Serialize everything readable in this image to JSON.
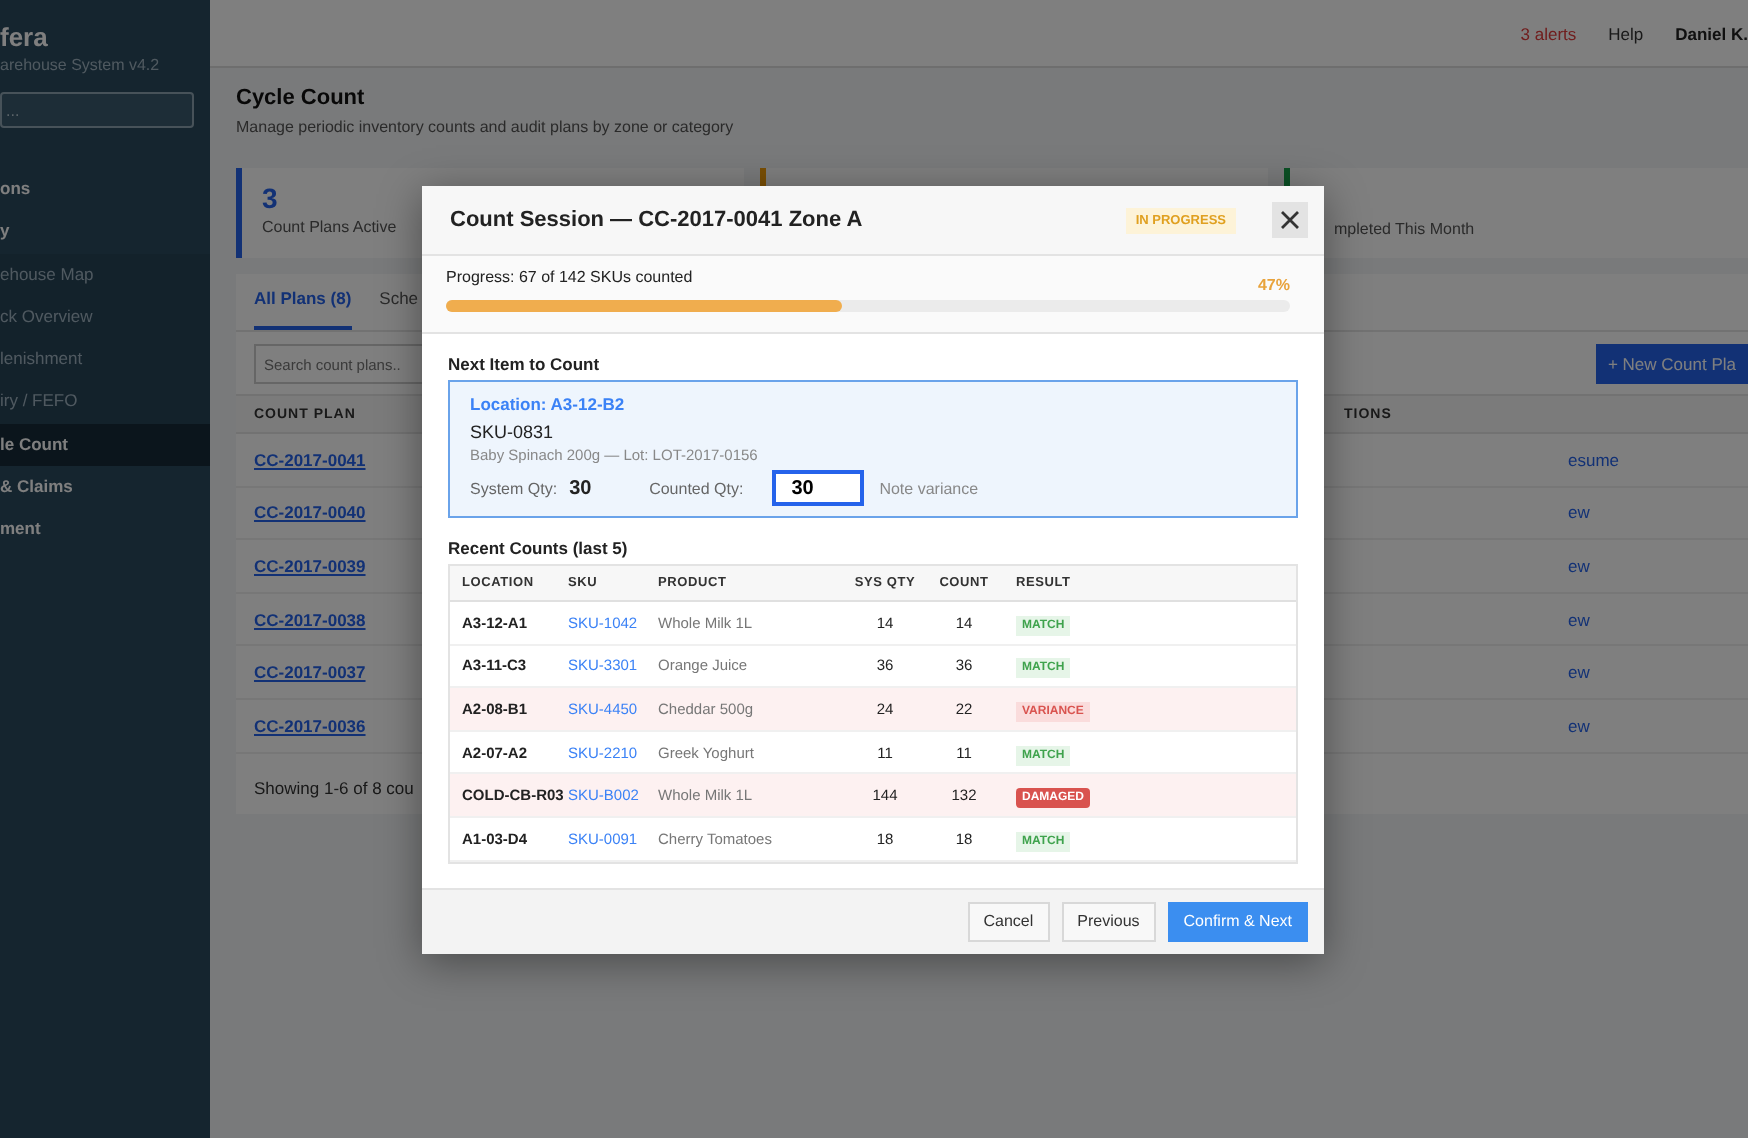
{
  "sidebar": {
    "brand": "fera",
    "subtitle": "arehouse System v4.2",
    "search_placeholder": "...",
    "items": [
      {
        "label": "ons",
        "selected": false,
        "kind": "section"
      },
      {
        "label": "y",
        "selected": false,
        "kind": "section"
      },
      {
        "label": "ehouse Map",
        "selected": false,
        "kind": "sub"
      },
      {
        "label": "ck Overview",
        "selected": false,
        "kind": "sub"
      },
      {
        "label": "lenishment",
        "selected": false,
        "kind": "sub"
      },
      {
        "label": "iry / FEFO",
        "selected": false,
        "kind": "sub"
      },
      {
        "label": "le Count",
        "selected": true,
        "kind": "sub"
      },
      {
        "label": "& Claims",
        "selected": false,
        "kind": "section"
      },
      {
        "label": "ment",
        "selected": false,
        "kind": "section"
      }
    ]
  },
  "topbar": {
    "alerts": "3 alerts",
    "help": "Help",
    "user": "Daniel K."
  },
  "page": {
    "title": "Cycle Count",
    "subtitle": "Manage periodic inventory counts and audit plans by zone or category"
  },
  "stats": [
    {
      "value": "3",
      "label": "Count Plans Active"
    },
    {
      "label": "mpleted This Month"
    }
  ],
  "tabs": [
    {
      "label": "All Plans (8)",
      "selected": true
    },
    {
      "label": "Sche",
      "selected": false
    }
  ],
  "search": {
    "placeholder": "Search count plans.."
  },
  "new_button": "+ New Count Pla",
  "plans_table": {
    "columns": [
      "COUNT PLAN",
      "TIONS"
    ],
    "rows": [
      {
        "plan": "CC-2017-0041",
        "action": "esume"
      },
      {
        "plan": "CC-2017-0040",
        "action": "ew"
      },
      {
        "plan": "CC-2017-0039",
        "action": "ew"
      },
      {
        "plan": "CC-2017-0038",
        "action": "ew"
      },
      {
        "plan": "CC-2017-0037",
        "action": "ew"
      },
      {
        "plan": "CC-2017-0036",
        "action": "ew"
      }
    ],
    "footer": "Showing 1-6 of 8 cou"
  },
  "modal": {
    "title": "Count Session — CC-2017-0041 Zone A",
    "status": "IN PROGRESS",
    "progress": {
      "label": "Progress: 67 of 142 SKUs counted",
      "percent": "47%",
      "level": 0.47
    },
    "next_item": {
      "heading": "Next Item to Count",
      "location": "Location: A3-12-B2",
      "sku": "SKU-0831",
      "description": "Baby Spinach 200g — Lot: LOT-2017-0156",
      "system_qty_label": "System Qty:",
      "system_qty": "30",
      "counted_qty_label": "Counted Qty:",
      "counted_qty": "30",
      "note": "Note variance"
    },
    "recent_heading": "Recent Counts (last 5)",
    "columns": [
      "LOCATION",
      "SKU",
      "PRODUCT",
      "SYS QTY",
      "COUNT",
      "RESULT"
    ],
    "rows": [
      {
        "location": "A3-12-A1",
        "sku": "SKU-1042",
        "product": "Whole Milk 1L",
        "sys_qty": "14",
        "count": "14",
        "result": "MATCH",
        "kind": "match"
      },
      {
        "location": "A3-11-C3",
        "sku": "SKU-3301",
        "product": "Orange Juice",
        "sys_qty": "36",
        "count": "36",
        "result": "MATCH",
        "kind": "match"
      },
      {
        "location": "A2-08-B1",
        "sku": "SKU-4450",
        "product": "Cheddar 500g",
        "sys_qty": "24",
        "count": "22",
        "result": "VARIANCE",
        "kind": "variance"
      },
      {
        "location": "A2-07-A2",
        "sku": "SKU-2210",
        "product": "Greek Yoghurt",
        "sys_qty": "11",
        "count": "11",
        "result": "MATCH",
        "kind": "match"
      },
      {
        "location": "COLD-CB-R03",
        "sku": "SKU-B002",
        "product": "Whole Milk 1L",
        "sys_qty": "144",
        "count": "132",
        "result": "DAMAGED",
        "kind": "damaged"
      },
      {
        "location": "A1-03-D4",
        "sku": "SKU-0091",
        "product": "Cherry Tomatoes",
        "sys_qty": "18",
        "count": "18",
        "result": "MATCH",
        "kind": "match"
      }
    ],
    "buttons": [
      {
        "label": "Cancel",
        "kind": "secondary"
      },
      {
        "label": "Previous",
        "kind": "secondary"
      },
      {
        "label": "Confirm & Next",
        "kind": "primary"
      }
    ]
  }
}
